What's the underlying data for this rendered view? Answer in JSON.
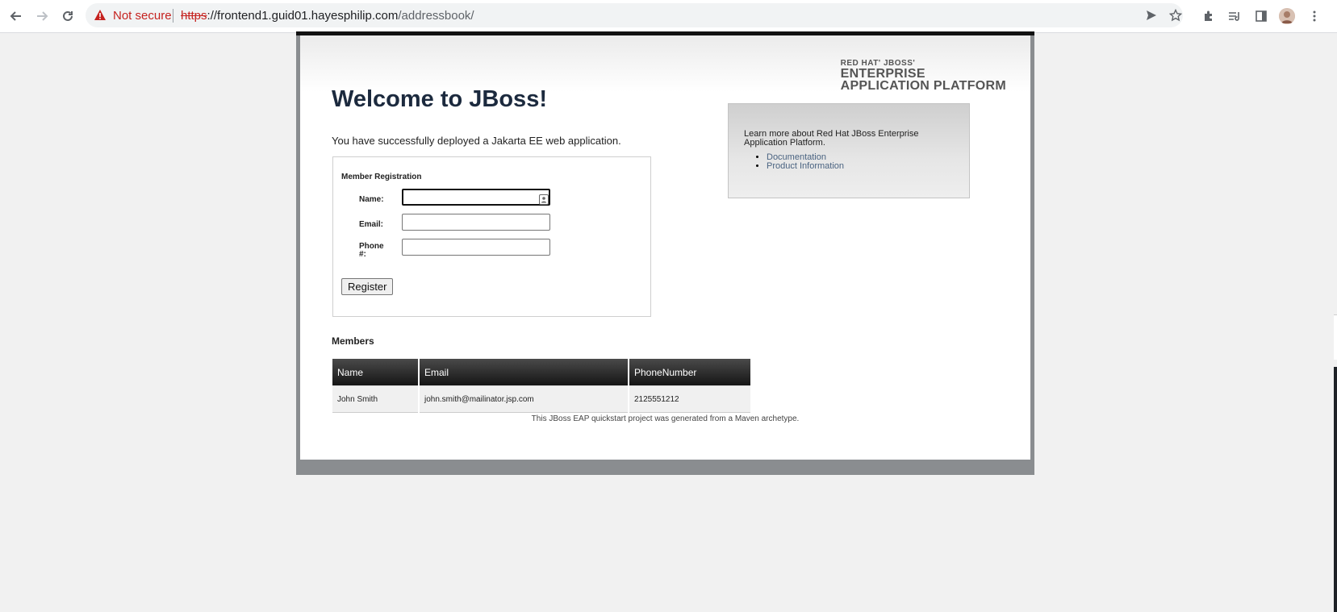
{
  "browser": {
    "security_label": "Not secure",
    "url_scheme": "https",
    "url_sep": "://",
    "url_host": "frontend1.guid01.hayesphilip.com",
    "url_path": "/addressbook/",
    "icons": [
      "back-icon",
      "forward-icon",
      "reload-icon",
      "warning-icon",
      "send-icon",
      "star-icon",
      "extensions-icon",
      "reading-list-icon",
      "side-panel-icon",
      "avatar",
      "menu-icon"
    ]
  },
  "brand": {
    "line1": "RED HAT' JBOSS'",
    "line2": "ENTERPRISE",
    "line3": "APPLICATION PLATFORM"
  },
  "page": {
    "heading": "Welcome to JBoss!",
    "deployed_text": "You have successfully deployed a Jakarta EE web application."
  },
  "registration": {
    "title": "Member Registration",
    "name_label": "Name:",
    "email_label": "Email:",
    "phone_label": "Phone #:",
    "name_value": "",
    "email_value": "",
    "phone_value": "",
    "register_label": "Register"
  },
  "members": {
    "title": "Members",
    "columns": [
      "Name",
      "Email",
      "PhoneNumber"
    ],
    "rows": [
      [
        "John Smith",
        "john.smith@mailinator.jsp.com",
        "2125551212"
      ]
    ]
  },
  "aside": {
    "text": "Learn more about Red Hat JBoss Enterprise Application Platform.",
    "links": [
      "Documentation",
      "Product Information"
    ]
  },
  "footer": {
    "text": "This JBoss EAP quickstart project was generated from a Maven archetype."
  },
  "colors": {
    "heading": "#1c2a3e",
    "link": "#4a6381",
    "warning": "#c5221f"
  }
}
